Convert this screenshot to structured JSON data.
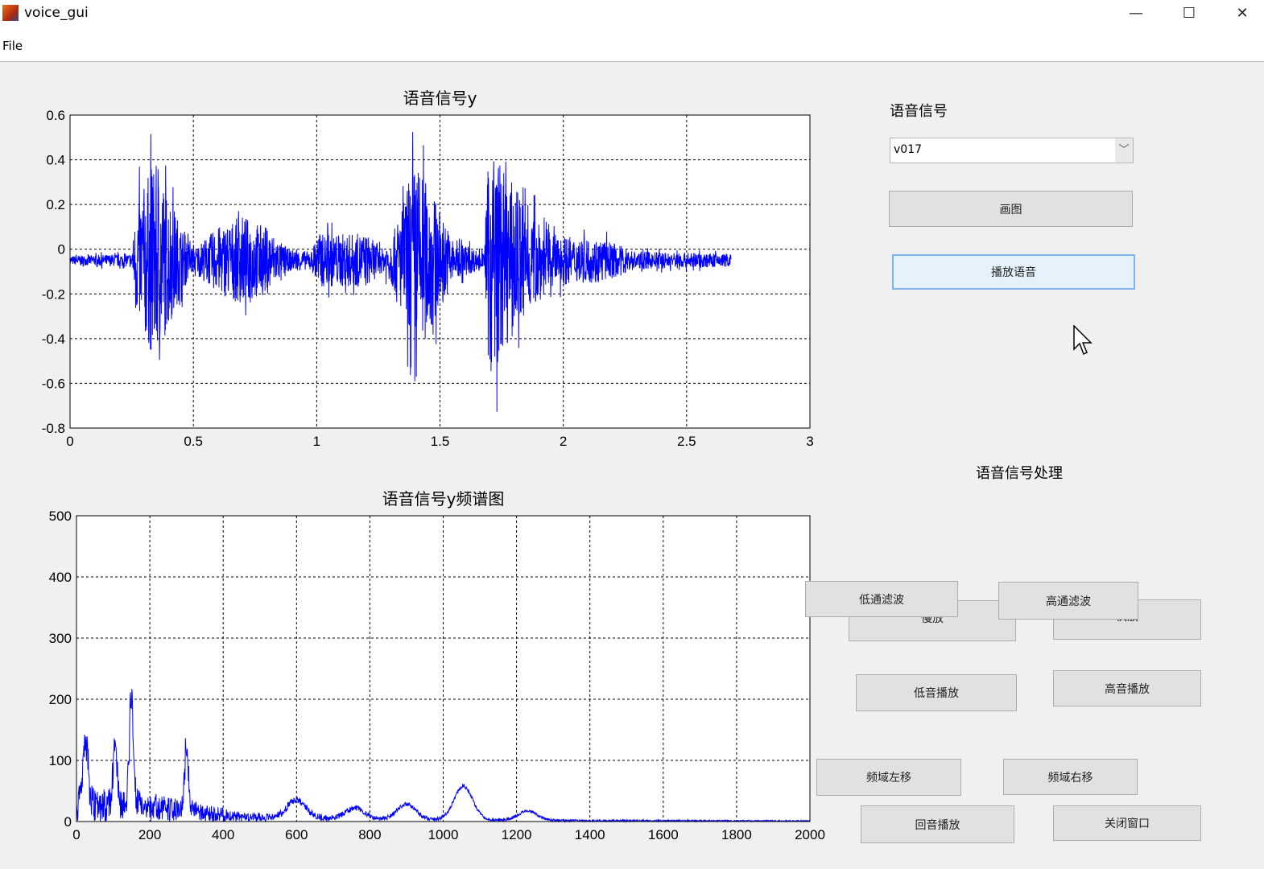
{
  "window": {
    "title": "voice_gui",
    "minimize": "—",
    "maximize": "☐",
    "close": "✕"
  },
  "menu": {
    "file": "File"
  },
  "panel": {
    "signal_label": "语音信号",
    "dropdown_value": "v017",
    "plot_button": "画图",
    "play_button": "播放语音",
    "processing_label": "语音信号处理"
  },
  "buttons": {
    "slow": "慢放",
    "fast": "快放",
    "lowpass": "低通滤波",
    "highpass": "高通滤波",
    "bass": "低音播放",
    "treble": "高音播放",
    "shift_left": "频域左移",
    "shift_right": "频域右移",
    "echo": "回音播放",
    "close_window": "关闭窗口"
  },
  "colors": {
    "line": "#0000ff",
    "button": "#e1e1e1",
    "focus": "#e5f1fb"
  },
  "chart_data": [
    {
      "type": "line",
      "title": "语音信号y",
      "xlim": [
        0,
        3
      ],
      "ylim": [
        -0.8,
        0.6
      ],
      "grid": true,
      "xticks": [
        "0",
        "0.5",
        "1",
        "1.5",
        "2",
        "2.5",
        "3"
      ],
      "xtick_values": [
        0,
        0.5,
        1,
        1.5,
        2,
        2.5,
        3
      ],
      "yticks": [
        "0.6",
        "0.4",
        "0.2",
        "0",
        "-0.2",
        "-0.4",
        "-0.6",
        "-0.8"
      ],
      "ytick_values": [
        0.6,
        0.4,
        0.2,
        0,
        -0.2,
        -0.4,
        -0.6,
        -0.8
      ],
      "offset": -0.05,
      "duration": 2.68,
      "envelope": [
        [
          0,
          0.02
        ],
        [
          0.25,
          0.03
        ],
        [
          0.27,
          0.25
        ],
        [
          0.34,
          0.45
        ],
        [
          0.4,
          0.3
        ],
        [
          0.45,
          0.15
        ],
        [
          0.5,
          0.05
        ],
        [
          0.6,
          0.15
        ],
        [
          0.7,
          0.2
        ],
        [
          0.8,
          0.15
        ],
        [
          0.88,
          0.05
        ],
        [
          0.98,
          0.04
        ],
        [
          1.0,
          0.12
        ],
        [
          1.2,
          0.12
        ],
        [
          1.27,
          0.05
        ],
        [
          1.32,
          0.15
        ],
        [
          1.4,
          0.45
        ],
        [
          1.47,
          0.3
        ],
        [
          1.55,
          0.1
        ],
        [
          1.68,
          0.03
        ],
        [
          1.7,
          0.55
        ],
        [
          1.76,
          0.4
        ],
        [
          1.85,
          0.25
        ],
        [
          1.95,
          0.12
        ],
        [
          2.05,
          0.1
        ],
        [
          2.15,
          0.1
        ],
        [
          2.3,
          0.04
        ],
        [
          2.68,
          0.03
        ]
      ]
    },
    {
      "type": "line",
      "title": "语音信号y频谱图",
      "xlim": [
        0,
        2000
      ],
      "ylim": [
        0,
        500
      ],
      "grid": true,
      "xticks": [
        "0",
        "200",
        "400",
        "600",
        "800",
        "1000",
        "1200",
        "1400",
        "1600",
        "1800",
        "2000"
      ],
      "xtick_values": [
        0,
        200,
        400,
        600,
        800,
        1000,
        1200,
        1400,
        1600,
        1800,
        2000
      ],
      "yticks": [
        "500",
        "400",
        "300",
        "200",
        "100",
        "0"
      ],
      "ytick_values": [
        500,
        400,
        300,
        200,
        100,
        0
      ],
      "noise_floor": [
        [
          0,
          60
        ],
        [
          180,
          50
        ],
        [
          350,
          30
        ],
        [
          450,
          15
        ],
        [
          800,
          8
        ],
        [
          1400,
          3
        ],
        [
          2000,
          2
        ]
      ],
      "peaks": [
        [
          25,
          140
        ],
        [
          105,
          120
        ],
        [
          150,
          205
        ],
        [
          300,
          120
        ],
        [
          600,
          30
        ],
        [
          760,
          18
        ],
        [
          900,
          25
        ],
        [
          1055,
          55
        ],
        [
          1230,
          15
        ]
      ]
    }
  ]
}
